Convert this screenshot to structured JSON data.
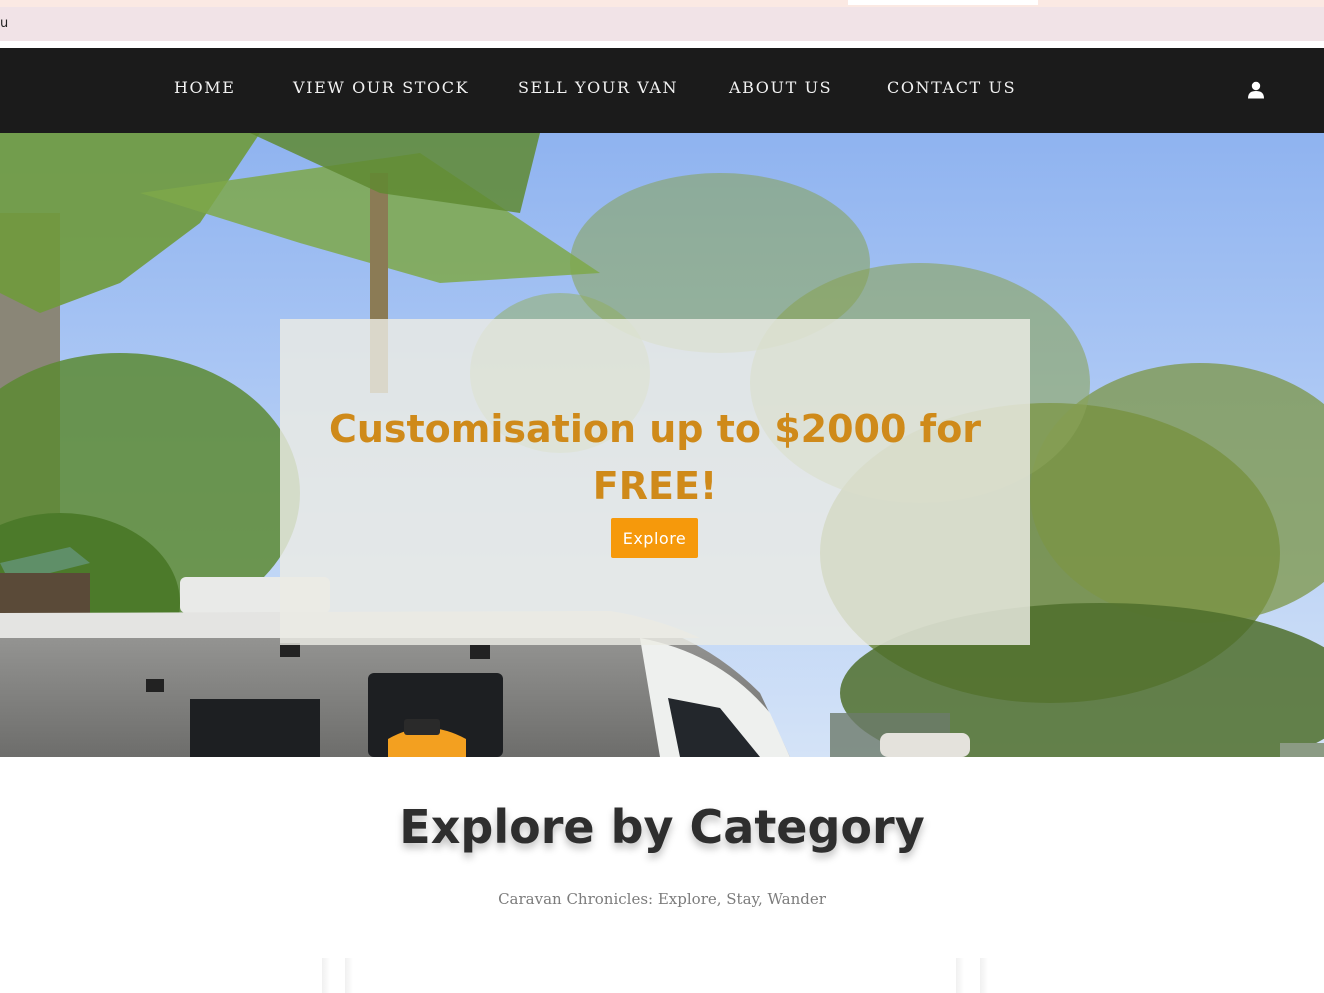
{
  "notice": {
    "text": "u"
  },
  "nav": {
    "items": [
      {
        "label": "HOME"
      },
      {
        "label": "VIEW OUR STOCK"
      },
      {
        "label": "SELL YOUR VAN"
      },
      {
        "label": "ABOUT US"
      },
      {
        "label": "CONTACT US"
      }
    ],
    "account_icon": "user-icon"
  },
  "hero": {
    "title_line1": "Customisation up to $2000 for",
    "title_line2": "FREE!",
    "button_label": "Explore",
    "colors": {
      "title": "#cf8a1a",
      "button": "#f6990b",
      "nav_bg": "#1b1b1b"
    }
  },
  "category": {
    "title": "Explore by Category",
    "subtitle": "Caravan Chronicles: Explore, Stay, Wander"
  }
}
